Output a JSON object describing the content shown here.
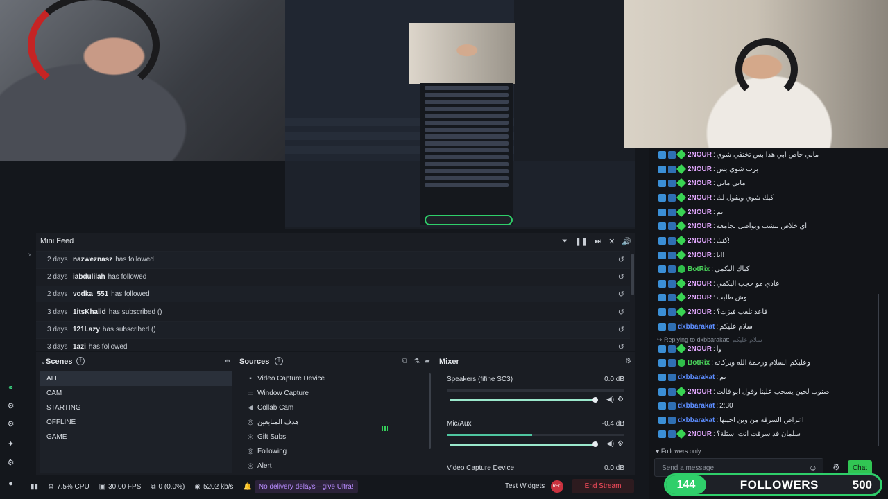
{
  "mini_feed": {
    "title": "Mini Feed",
    "rows": [
      {
        "time": "2 days",
        "user": "nazweznasz",
        "action": "has followed"
      },
      {
        "time": "2 days",
        "user": "iabdulilah",
        "action": "has followed"
      },
      {
        "time": "2 days",
        "user": "vodka_551",
        "action": "has followed"
      },
      {
        "time": "3 days",
        "user": "1itsKhalid",
        "action": "has subscribed ()"
      },
      {
        "time": "3 days",
        "user": "121Lazy",
        "action": "has subscribed ()"
      },
      {
        "time": "3 days",
        "user": "1azi",
        "action": "has followed"
      }
    ]
  },
  "scenes": {
    "title": "Scenes",
    "items": [
      "ALL",
      "CAM",
      "STARTING",
      "OFFLINE",
      "GAME"
    ],
    "selected": "ALL"
  },
  "sources": {
    "title": "Sources",
    "items": [
      {
        "label": "Video Capture Device",
        "icon": "camera-icon"
      },
      {
        "label": "Window Capture",
        "icon": "window-icon"
      },
      {
        "label": "Collab Cam",
        "icon": "speaker-icon"
      },
      {
        "label": "هدف المتابعين",
        "icon": "globe-icon"
      },
      {
        "label": "Gift Subs",
        "icon": "globe-icon"
      },
      {
        "label": "Following",
        "icon": "globe-icon"
      },
      {
        "label": "Alert",
        "icon": "globe-icon"
      }
    ]
  },
  "mixer": {
    "title": "Mixer",
    "channels": [
      {
        "name": "Speakers (fifine SC3)",
        "db": "0.0 dB",
        "level": 0.0,
        "volume": 0.82
      },
      {
        "name": "Mic/Aux",
        "db": "-0.4 dB",
        "level": 0.48,
        "volume": 0.82
      },
      {
        "name": "Video Capture Device",
        "db": "0.0 dB",
        "level": 0.0,
        "volume": 0.82
      }
    ]
  },
  "status_bar": {
    "cpu": "7.5% CPU",
    "fps": "30.00 FPS",
    "dropped": "0 (0.0%)",
    "bitrate": "5202 kb/s",
    "ultra_notice": "No delivery delays—give Ultra!",
    "test_widgets": "Test Widgets",
    "end_stream": "End Stream"
  },
  "chat": {
    "messages": [
      {
        "user": "2NOUR",
        "color": "#e3a8ff",
        "text": "ماني خاص ابي هذا بس تختفي شوي",
        "bot": false
      },
      {
        "user": "2NOUR",
        "color": "#e3a8ff",
        "text": "برب شوي بس",
        "bot": false
      },
      {
        "user": "2NOUR",
        "color": "#e3a8ff",
        "text": "ماني ماني",
        "bot": false
      },
      {
        "user": "2NOUR",
        "color": "#e3a8ff",
        "text": "كبك شوي وبقول لك",
        "bot": false
      },
      {
        "user": "2NOUR",
        "color": "#e3a8ff",
        "text": "تم",
        "bot": false
      },
      {
        "user": "2NOUR",
        "color": "#e3a8ff",
        "text": "اي خلاص بنشب ويواصل لجامعه",
        "bot": false
      },
      {
        "user": "2NOUR",
        "color": "#e3a8ff",
        "text": "كنك!",
        "bot": false
      },
      {
        "user": "2NOUR",
        "color": "#e3a8ff",
        "text": "انا!",
        "bot": false
      },
      {
        "user": "BotRix",
        "color": "#49d25a",
        "text": "كباك البكمي",
        "bot": true
      },
      {
        "user": "2NOUR",
        "color": "#e3a8ff",
        "text": "عادي مو حجب البكمي",
        "bot": false
      },
      {
        "user": "2NOUR",
        "color": "#e3a8ff",
        "text": "وش طلبت",
        "bot": false
      },
      {
        "user": "2NOUR",
        "color": "#e3a8ff",
        "text": "قاعد تلعب فيزت؟",
        "bot": false
      },
      {
        "user": "dxbbarakat",
        "color": "#5c8dff",
        "text": "سلام عليكم",
        "bot": false
      },
      {
        "user": "2NOUR",
        "color": "#e3a8ff",
        "text": "وا",
        "bot": false
      },
      {
        "user": "BotRix",
        "color": "#49d25a",
        "text": "وعليكم السلام ورحمة الله وبركاته",
        "bot": true
      },
      {
        "user": "dxbbarakat",
        "color": "#5c8dff",
        "text": "تم",
        "bot": false
      },
      {
        "user": "2NOUR",
        "color": "#e3a8ff",
        "text": "صنوب لحين يسحب علينا وقول ابو فالت",
        "bot": false
      },
      {
        "user": "dxbbarakat",
        "color": "#5c8dff",
        "text": "2:30",
        "bot": false
      },
      {
        "user": "dxbbarakat",
        "color": "#5c8dff",
        "text": "اعراض السرقه من وين اجيبها",
        "bot": false
      },
      {
        "user": "2NOUR",
        "color": "#e3a8ff",
        "text": "سلمان قد سرقت انت اسئلة؟",
        "bot": false
      }
    ],
    "reply_label": "Replying to dxbbarakat:",
    "reply_quote": "سلام عليكم",
    "followers_only": "Followers only",
    "input_placeholder": "Send a message",
    "chat_button": "Chat"
  },
  "followers_widget": {
    "count": "144",
    "label": "FOLLOWERS",
    "goal": "500"
  },
  "colors": {
    "accent_green": "#2fcf6a",
    "end_stream_red": "#ff4d5e",
    "ultra_purple": "#b98cff"
  }
}
